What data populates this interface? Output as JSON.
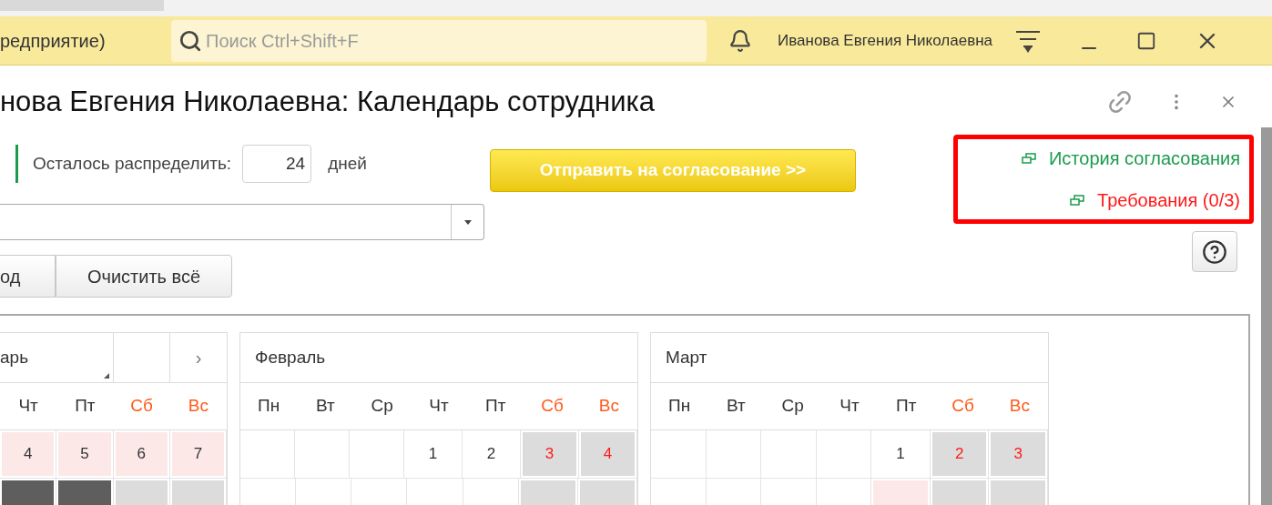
{
  "top_bar": {
    "app_title": "редприятие)",
    "search": {
      "placeholder": "Поиск Ctrl+Shift+F"
    },
    "user": "Иванова Евгения Николаевна"
  },
  "form": {
    "title": "нова Евгения Николаевна: Календарь сотрудника",
    "remaining": {
      "label": "Осталось распределить:",
      "value": "24",
      "unit": "дней"
    },
    "send_button": "Отправить на согласование >>",
    "links": [
      {
        "label": "История согласования",
        "color": "#1a9b4b"
      },
      {
        "label": "Требования (0/3)",
        "color": "#ff1a1a"
      }
    ],
    "buttons": [
      "од",
      "Очистить всё"
    ]
  },
  "calendars": [
    {
      "month": "арь",
      "nav": "›",
      "weekdays": [
        {
          "label": "Чт",
          "weekend": false
        },
        {
          "label": "Пт",
          "weekend": false
        },
        {
          "label": "Сб",
          "weekend": true
        },
        {
          "label": "Вс",
          "weekend": true
        }
      ],
      "weeks": [
        [
          {
            "day": "4",
            "kind": "vacation"
          },
          {
            "day": "5",
            "kind": "vacation"
          },
          {
            "day": "6",
            "kind": "vacation"
          },
          {
            "day": "7",
            "kind": "vacation"
          }
        ],
        [
          {
            "kind": "selected"
          },
          {
            "kind": "selected"
          },
          {
            "kind": "weekend"
          },
          {
            "kind": "weekend"
          }
        ]
      ]
    },
    {
      "month": "Февраль",
      "weekdays": [
        {
          "label": "Пн",
          "weekend": false
        },
        {
          "label": "Вт",
          "weekend": false
        },
        {
          "label": "Ср",
          "weekend": false
        },
        {
          "label": "Чт",
          "weekend": false
        },
        {
          "label": "Пт",
          "weekend": false
        },
        {
          "label": "Сб",
          "weekend": true
        },
        {
          "label": "Вс",
          "weekend": true
        }
      ],
      "weeks": [
        [
          {
            "kind": "empty"
          },
          {
            "kind": "empty"
          },
          {
            "kind": "empty"
          },
          {
            "day": "1",
            "kind": "plain"
          },
          {
            "day": "2",
            "kind": "plain"
          },
          {
            "day": "3",
            "kind": "weekend"
          },
          {
            "day": "4",
            "kind": "weekend"
          }
        ],
        [
          {
            "kind": "plain"
          },
          {
            "kind": "plain"
          },
          {
            "kind": "plain"
          },
          {
            "kind": "plain"
          },
          {
            "kind": "plain"
          },
          {
            "kind": "weekend"
          },
          {
            "kind": "weekend"
          }
        ]
      ]
    },
    {
      "month": "Март",
      "weekdays": [
        {
          "label": "Пн",
          "weekend": false
        },
        {
          "label": "Вт",
          "weekend": false
        },
        {
          "label": "Ср",
          "weekend": false
        },
        {
          "label": "Чт",
          "weekend": false
        },
        {
          "label": "Пт",
          "weekend": false
        },
        {
          "label": "Сб",
          "weekend": true
        },
        {
          "label": "Вс",
          "weekend": true
        }
      ],
      "weeks": [
        [
          {
            "kind": "empty"
          },
          {
            "kind": "empty"
          },
          {
            "kind": "empty"
          },
          {
            "kind": "empty"
          },
          {
            "day": "1",
            "kind": "plain"
          },
          {
            "day": "2",
            "kind": "weekend"
          },
          {
            "day": "3",
            "kind": "weekend"
          }
        ],
        [
          {
            "kind": "plain"
          },
          {
            "kind": "plain"
          },
          {
            "kind": "plain"
          },
          {
            "kind": "plain"
          },
          {
            "kind": "vacation"
          },
          {
            "kind": "weekend"
          },
          {
            "kind": "weekend"
          }
        ]
      ]
    }
  ]
}
